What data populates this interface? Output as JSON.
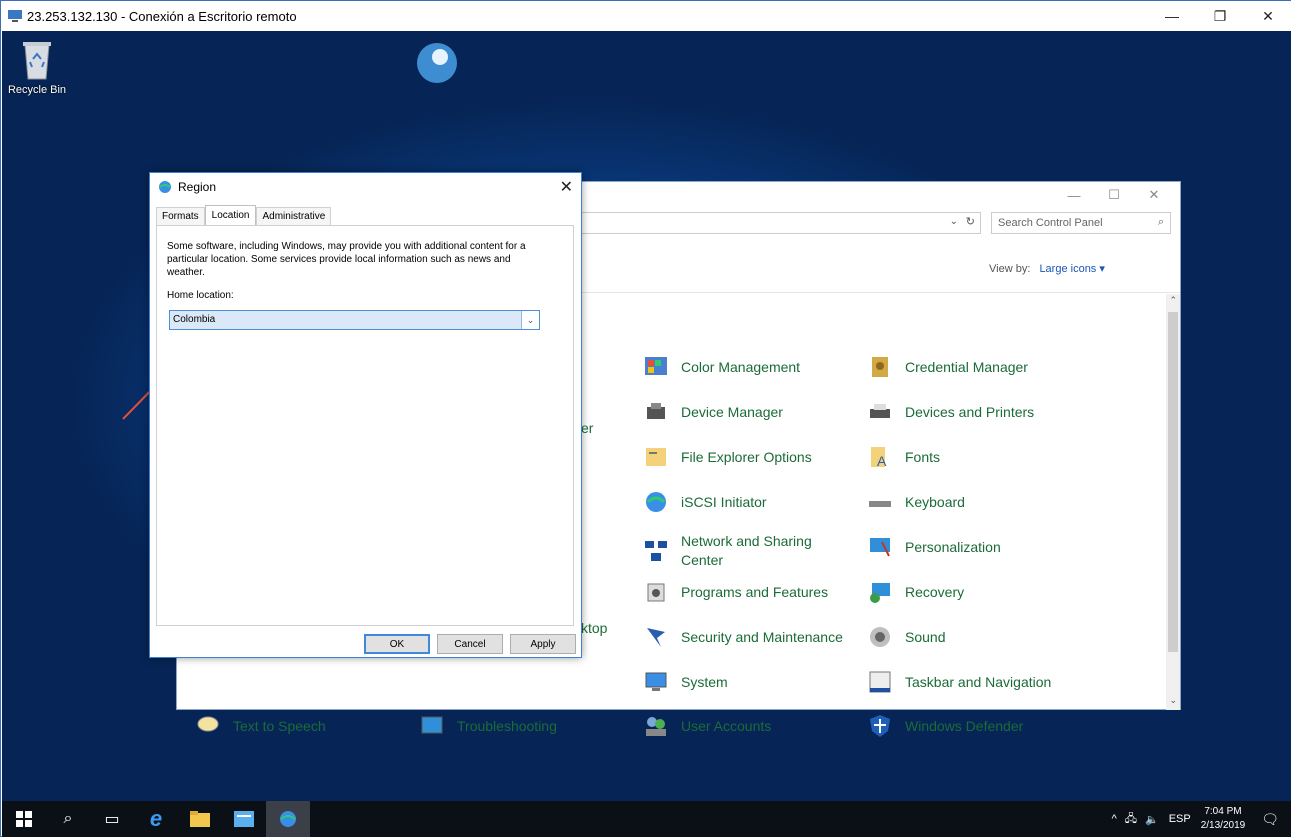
{
  "rdp": {
    "title": "23.253.132.130 - Conexión a Escritorio remoto",
    "min": "—",
    "max": "❐",
    "close": "✕"
  },
  "desktop": {
    "recycle_bin": "Recycle Bin"
  },
  "control_panel": {
    "search_placeholder": "Search Control Panel",
    "view_by_label": "View by:",
    "view_by_value": "Large icons",
    "items_col3": [
      "Color Management",
      "Device Manager",
      "File Explorer Options",
      "iSCSI Initiator",
      "Network and Sharing Center",
      "Programs and Features",
      "Security and Maintenance",
      "System",
      "User Accounts"
    ],
    "items_col4": [
      "Credential Manager",
      "Devices and Printers",
      "Fonts",
      "Keyboard",
      "Personalization",
      "Recovery",
      "Sound",
      "Taskbar and Navigation",
      "Windows Defender"
    ],
    "items_bottom": [
      "Text to Speech",
      "Troubleshooting"
    ],
    "partial_er": "er",
    "partial_ktop": "ktop"
  },
  "region_dialog": {
    "title": "Region",
    "tabs": [
      "Formats",
      "Location",
      "Administrative"
    ],
    "description": "Some software, including Windows, may provide you with additional content for a particular location. Some services provide local information such as news and weather.",
    "home_location_label": "Home location:",
    "home_location_value": "Colombia",
    "ok": "OK",
    "cancel": "Cancel",
    "apply": "Apply"
  },
  "taskbar": {
    "lang": "ESP",
    "time": "7:04 PM",
    "date": "2/13/2019"
  }
}
